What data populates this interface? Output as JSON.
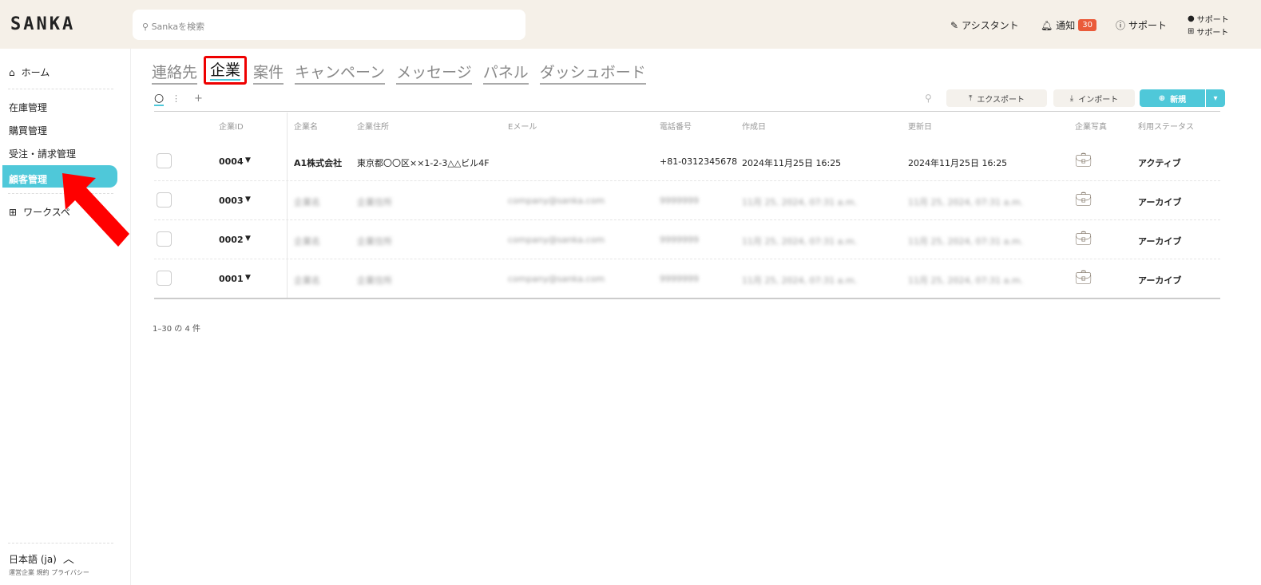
{
  "header": {
    "logo": "SANKA",
    "search_placeholder": "Sankaを検索",
    "assistant": "アシスタント",
    "notifications": "通知",
    "notification_count": "30",
    "support": "サポート",
    "user_line1": "サポート",
    "user_line2": "サポート"
  },
  "sidebar": {
    "home": "ホーム",
    "items": [
      "在庫管理",
      "購買管理",
      "受注・請求管理",
      "顧客管理"
    ],
    "active_index": 3,
    "workspace": "ワークスペ",
    "language": "日本語 (ja)",
    "footer_links": "運営企業 規約 プライバシー"
  },
  "tabs": [
    "連絡先",
    "企業",
    "案件",
    "キャンペーン",
    "メッセージ",
    "パネル",
    "ダッシュボード"
  ],
  "active_tab": "企業",
  "toolbar": {
    "export": "エクスポート",
    "import": "インポート",
    "new": "新規",
    "add": "+"
  },
  "columns": [
    "企業ID",
    "企業名",
    "企業住所",
    "Eメール",
    "電話番号",
    "作成日",
    "更新日",
    "企業写真",
    "利用ステータス"
  ],
  "rows": [
    {
      "id": "0004",
      "name": "A1株式会社",
      "address": "東京都〇〇区××1-2-3△△ビル4F",
      "email": "",
      "phone": "+81-0312345678",
      "created": "2024年11月25日 16:25",
      "updated": "2024年11月25日 16:25",
      "status": "アクティブ",
      "blurred": false
    },
    {
      "id": "0003",
      "name": "企業名",
      "address": "企業住所",
      "email": "company@sanka.com",
      "phone": "9999999",
      "created": "11月 25, 2024, 07:31 a.m.",
      "updated": "11月 25, 2024, 07:31 a.m.",
      "status": "アーカイブ",
      "blurred": true
    },
    {
      "id": "0002",
      "name": "企業名",
      "address": "企業住所",
      "email": "company@sanka.com",
      "phone": "9999999",
      "created": "11月 25, 2024, 07:31 a.m.",
      "updated": "11月 25, 2024, 07:31 a.m.",
      "status": "アーカイブ",
      "blurred": true
    },
    {
      "id": "0001",
      "name": "企業名",
      "address": "企業住所",
      "email": "company@sanka.com",
      "phone": "9999999",
      "created": "11月 25, 2024, 07:31 a.m.",
      "updated": "11月 25, 2024, 07:31 a.m.",
      "status": "アーカイブ",
      "blurred": true
    }
  ],
  "pagination": "1–30 の 4 件",
  "colors": {
    "accent": "#4fc8d9",
    "badge": "#ea5b3a",
    "highlight": "#e00000",
    "header_bg": "#f5f0e8"
  }
}
